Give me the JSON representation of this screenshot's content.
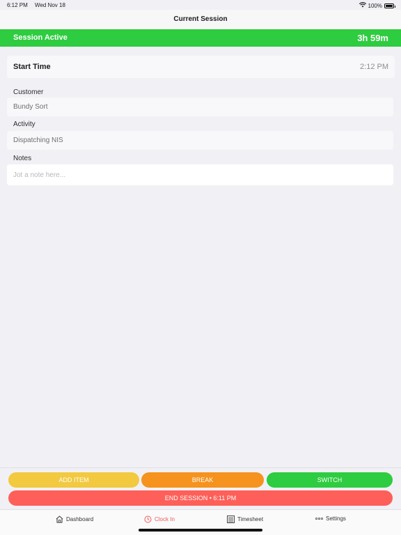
{
  "status_bar": {
    "time": "6:12 PM",
    "date": "Wed Nov 18",
    "battery": "100%",
    "icons": [
      "wifi-icon",
      "battery-icon"
    ]
  },
  "nav": {
    "title": "Current Session"
  },
  "banner": {
    "label": "Session Active",
    "timer": "3h 59m",
    "color": "#2ecc40"
  },
  "start": {
    "label": "Start Time",
    "value": "2:12 PM"
  },
  "fields": {
    "customer": {
      "label": "Customer",
      "value": "Bundy Sort"
    },
    "activity": {
      "label": "Activity",
      "value": "Dispatching NIS"
    },
    "notes": {
      "label": "Notes",
      "placeholder": "Jot a note here...",
      "value": ""
    }
  },
  "actions": {
    "add_item": "ADD ITEM",
    "break": "BREAK",
    "switch": "SWITCH",
    "end_session": "END SESSION • 6:11 PM",
    "colors": {
      "add_item": "#f2c93f",
      "break": "#f6921e",
      "switch": "#2ecc40",
      "end_session": "#fe5f58"
    }
  },
  "tabs": [
    {
      "label": "Dashboard",
      "icon": "home-icon",
      "active": false
    },
    {
      "label": "Clock In",
      "icon": "clock-icon",
      "active": true
    },
    {
      "label": "Timesheet",
      "icon": "timesheet-icon",
      "active": false
    },
    {
      "label": "Settings",
      "icon": "dots-icon",
      "active": false
    }
  ],
  "accent_color": "#f05a5a"
}
